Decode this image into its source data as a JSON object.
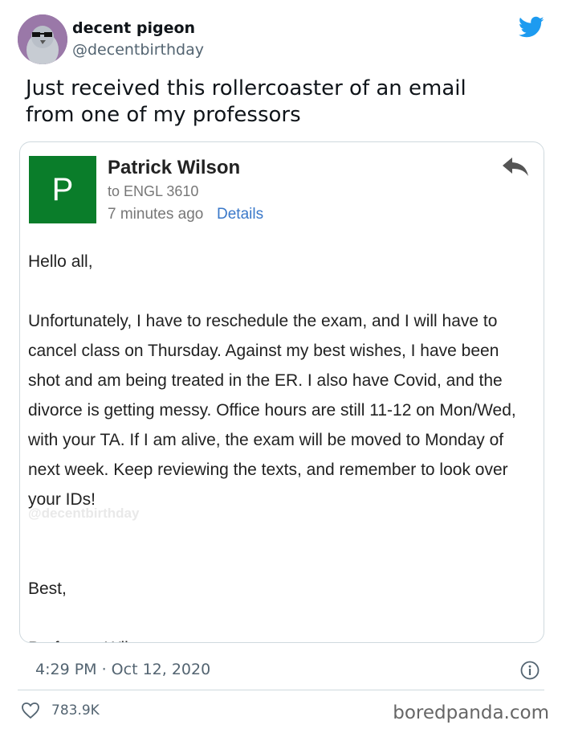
{
  "author": {
    "name": "decent pigeon",
    "handle": "@decentbirthday",
    "avatar_icon": "pigeon-with-glasses-avatar"
  },
  "tweet": {
    "text_line1": "Just received this rollercoaster of an email",
    "text_line2": "from one of my professors"
  },
  "email": {
    "avatar_letter": "P",
    "avatar_color": "#0a7d2a",
    "sender": "Patrick Wilson",
    "recipient": "to ENGL 3610",
    "time_ago": "7 minutes ago",
    "details_link": "Details",
    "reply_icon": "reply-arrow-icon",
    "greeting": "Hello all,",
    "body": "Unfortunately, I have to reschedule the exam, and I will have to cancel class on Thursday. Against my best wishes, I have been shot and am being treated in the ER. I also have Covid, and the divorce is getting messy. Office hours are still 11-12 on Mon/Wed, with your TA. If I am alive, the exam will be moved to Monday of next week. Keep reviewing the texts, and remember to look over your IDs!",
    "watermark": "@decentbirthday",
    "signoff": "Best,",
    "signature": "Professor Wilson"
  },
  "meta": {
    "timestamp": "4:29 PM · Oct 12, 2020",
    "likes": "783.9K",
    "site_watermark": "boredpanda.com",
    "brand_color": "#1d9bf0"
  }
}
